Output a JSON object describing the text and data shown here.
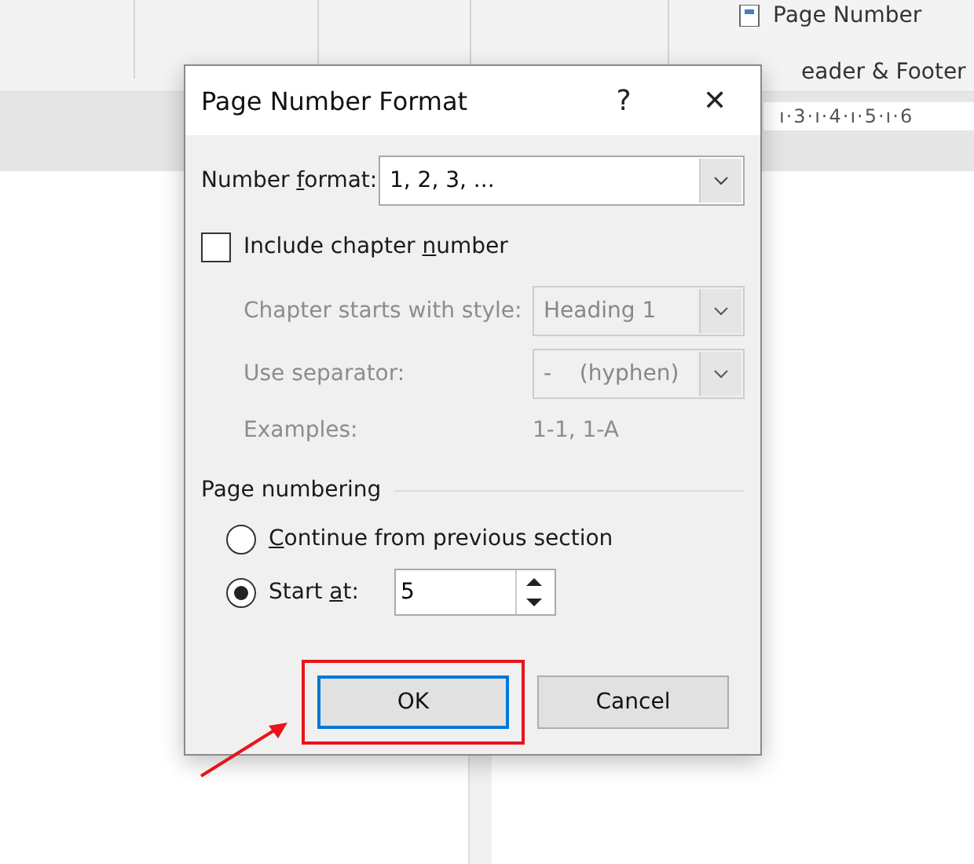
{
  "ribbon": {
    "page_number": "Page Number",
    "group_label": "eader & Footer",
    "ruler": "ı·3·ı·4·ı·5·ı·6"
  },
  "dialog": {
    "title": "Page Number Format",
    "help": "?",
    "close": "✕",
    "number_format": {
      "label": {
        "before": "Number ",
        "key": "f",
        "after": "ormat:"
      },
      "value": "1, 2, 3, ..."
    },
    "include_chapter": {
      "label": {
        "before": "Include chapter ",
        "key": "n",
        "after": "umber"
      },
      "checked": false
    },
    "chapter_rows": [
      {
        "kind": "combo",
        "label": "Chapter starts with style:",
        "value": "Heading 1",
        "disabled": true
      },
      {
        "kind": "combo",
        "label": "Use separator:",
        "value": "-    (hyphen)",
        "disabled": true
      },
      {
        "kind": "text",
        "label": "Examples:",
        "value": "1-1, 1-A",
        "disabled": true
      }
    ],
    "numbering": {
      "title": "Page numbering",
      "options": [
        {
          "label": {
            "key": "C",
            "after": "ontinue from previous section"
          },
          "selected": false
        },
        {
          "label": {
            "before": "Start ",
            "key": "a",
            "after": "t:"
          },
          "selected": true
        }
      ],
      "start_at": "5"
    },
    "buttons": [
      {
        "label": "OK",
        "focused": true,
        "highlighted": true
      },
      {
        "label": "Cancel",
        "focused": false,
        "highlighted": false
      }
    ]
  }
}
